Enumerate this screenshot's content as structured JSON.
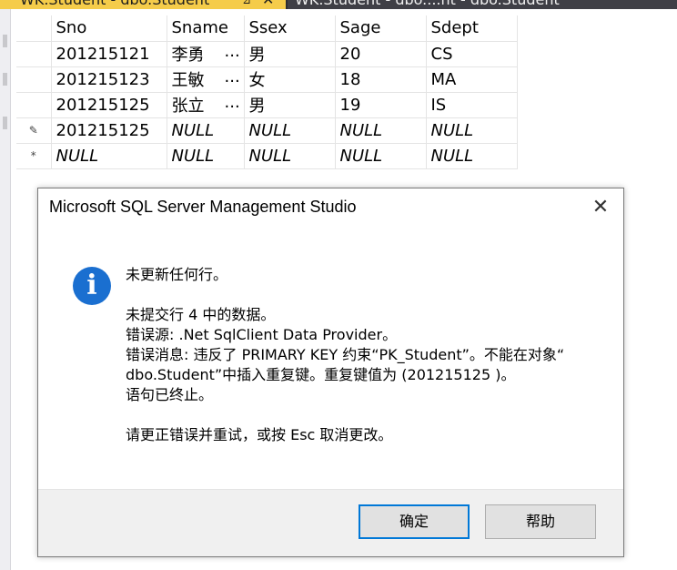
{
  "tabs": {
    "active": "WK.Student - dbo.Student",
    "pin": "⊿",
    "close": "✕",
    "inactive": "WK.Student - dbo....nt - dbo.Student"
  },
  "grid": {
    "headers": [
      "Sno",
      "Sname",
      "Ssex",
      "Sage",
      "Sdept"
    ],
    "rows": [
      {
        "marker": "",
        "cells": [
          "201215121",
          "李勇",
          "男",
          "20",
          "CS"
        ]
      },
      {
        "marker": "",
        "cells": [
          "201215123",
          "王敏",
          "女",
          "18",
          "MA"
        ]
      },
      {
        "marker": "",
        "cells": [
          "201215125",
          "张立",
          "男",
          "19",
          "IS"
        ]
      },
      {
        "marker": "✎",
        "cells": [
          "201215125",
          "NULL",
          "NULL",
          "NULL",
          "NULL"
        ]
      },
      {
        "marker": "*",
        "cells": [
          "NULL",
          "NULL",
          "NULL",
          "NULL",
          "NULL"
        ]
      }
    ],
    "ellipsis": "..."
  },
  "dialog": {
    "title": "Microsoft SQL Server Management Studio",
    "close": "✕",
    "icon": "i",
    "line1": "未更新任何行。",
    "line2": "未提交行 4 中的数据。",
    "line3": "错误源: .Net SqlClient Data Provider。",
    "line4": "错误消息: 违反了 PRIMARY KEY 约束“PK_Student”。不能在对象“",
    "line5": "dbo.Student”中插入重复键。重复键值为 (201215125  )。",
    "line6": "语句已终止。",
    "line7": "请更正错误并重试，或按 Esc 取消更改。",
    "ok_label": "确定",
    "help_label": "帮助"
  },
  "colors": {
    "active_tab": "#f5cc4a",
    "info_icon": "#1a6fd0",
    "default_button_border": "#0078d7"
  }
}
